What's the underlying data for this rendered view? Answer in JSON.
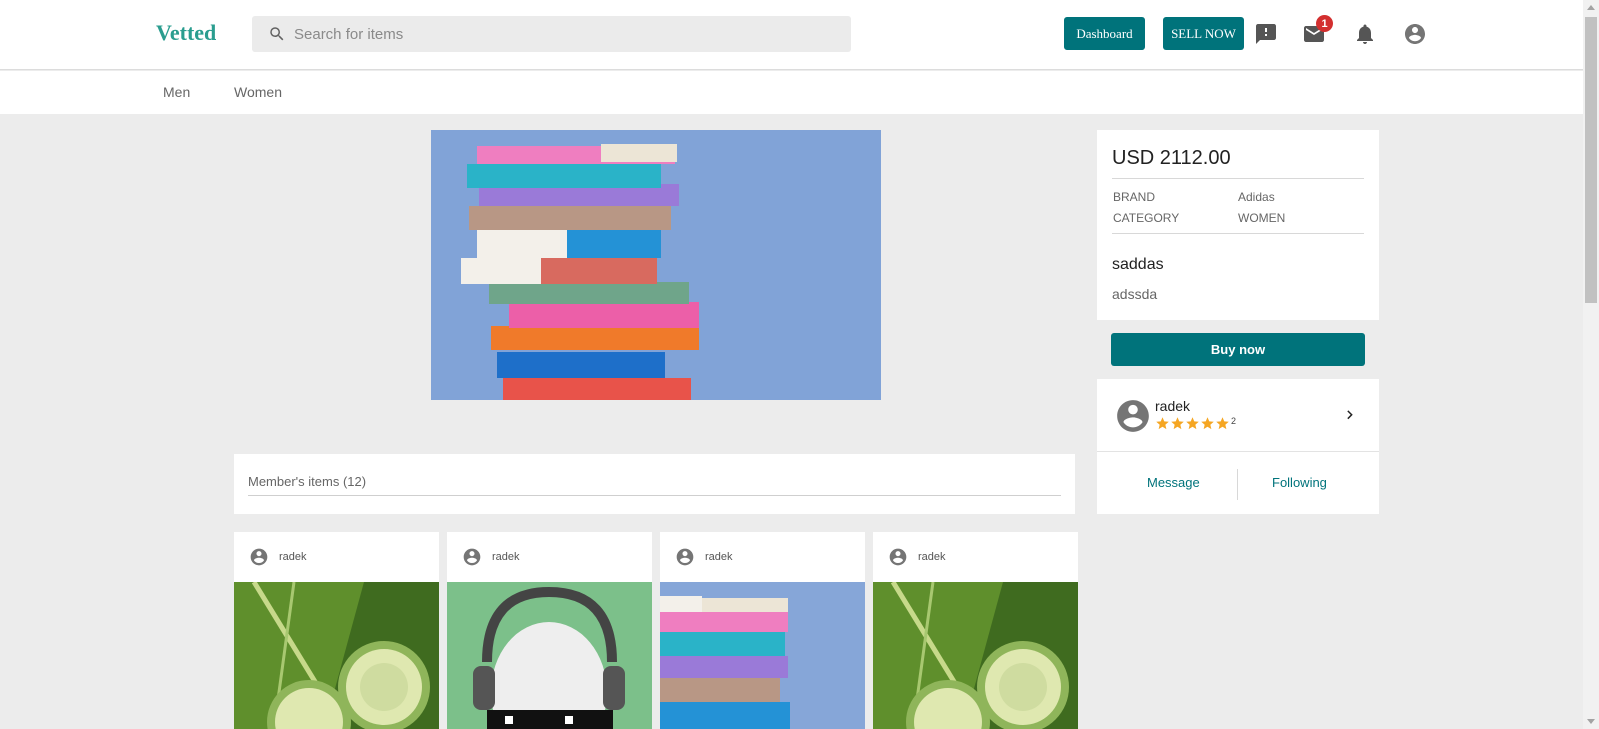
{
  "header": {
    "logo": "Vetted",
    "search": {
      "placeholder": "Search for items",
      "value": ""
    },
    "dashboard_label": "Dashboard",
    "sell_label": "SELL NOW",
    "messages_badge": "1",
    "icons": [
      "feedback-icon",
      "mail-icon",
      "bell-icon",
      "account-circle-icon"
    ]
  },
  "subnav": {
    "items": [
      {
        "label": "Men"
      },
      {
        "label": "Women"
      }
    ]
  },
  "product": {
    "price": "USD 2112.00",
    "details": [
      {
        "key": "BRAND",
        "value": "Adidas"
      },
      {
        "key": "CATEGORY",
        "value": "WOMEN"
      }
    ],
    "title": "saddas",
    "description": "adssda",
    "buy_label": "Buy now",
    "image": "stack-of-books"
  },
  "seller": {
    "name": "radek",
    "rating": 5,
    "rating_count": "2",
    "message_label": "Message",
    "following_label": "Following"
  },
  "members": {
    "heading": "Member's items (12)",
    "items": [
      {
        "user": "radek",
        "image": "lettuce-cucumber"
      },
      {
        "user": "radek",
        "image": "skull-headphones"
      },
      {
        "user": "radek",
        "image": "stack-of-books"
      },
      {
        "user": "radek",
        "image": "lettuce-cucumber"
      }
    ]
  },
  "colors": {
    "accent": "#00737b",
    "logo": "#2a9d8f",
    "badge": "#d32f2f",
    "star": "#f5a623"
  }
}
